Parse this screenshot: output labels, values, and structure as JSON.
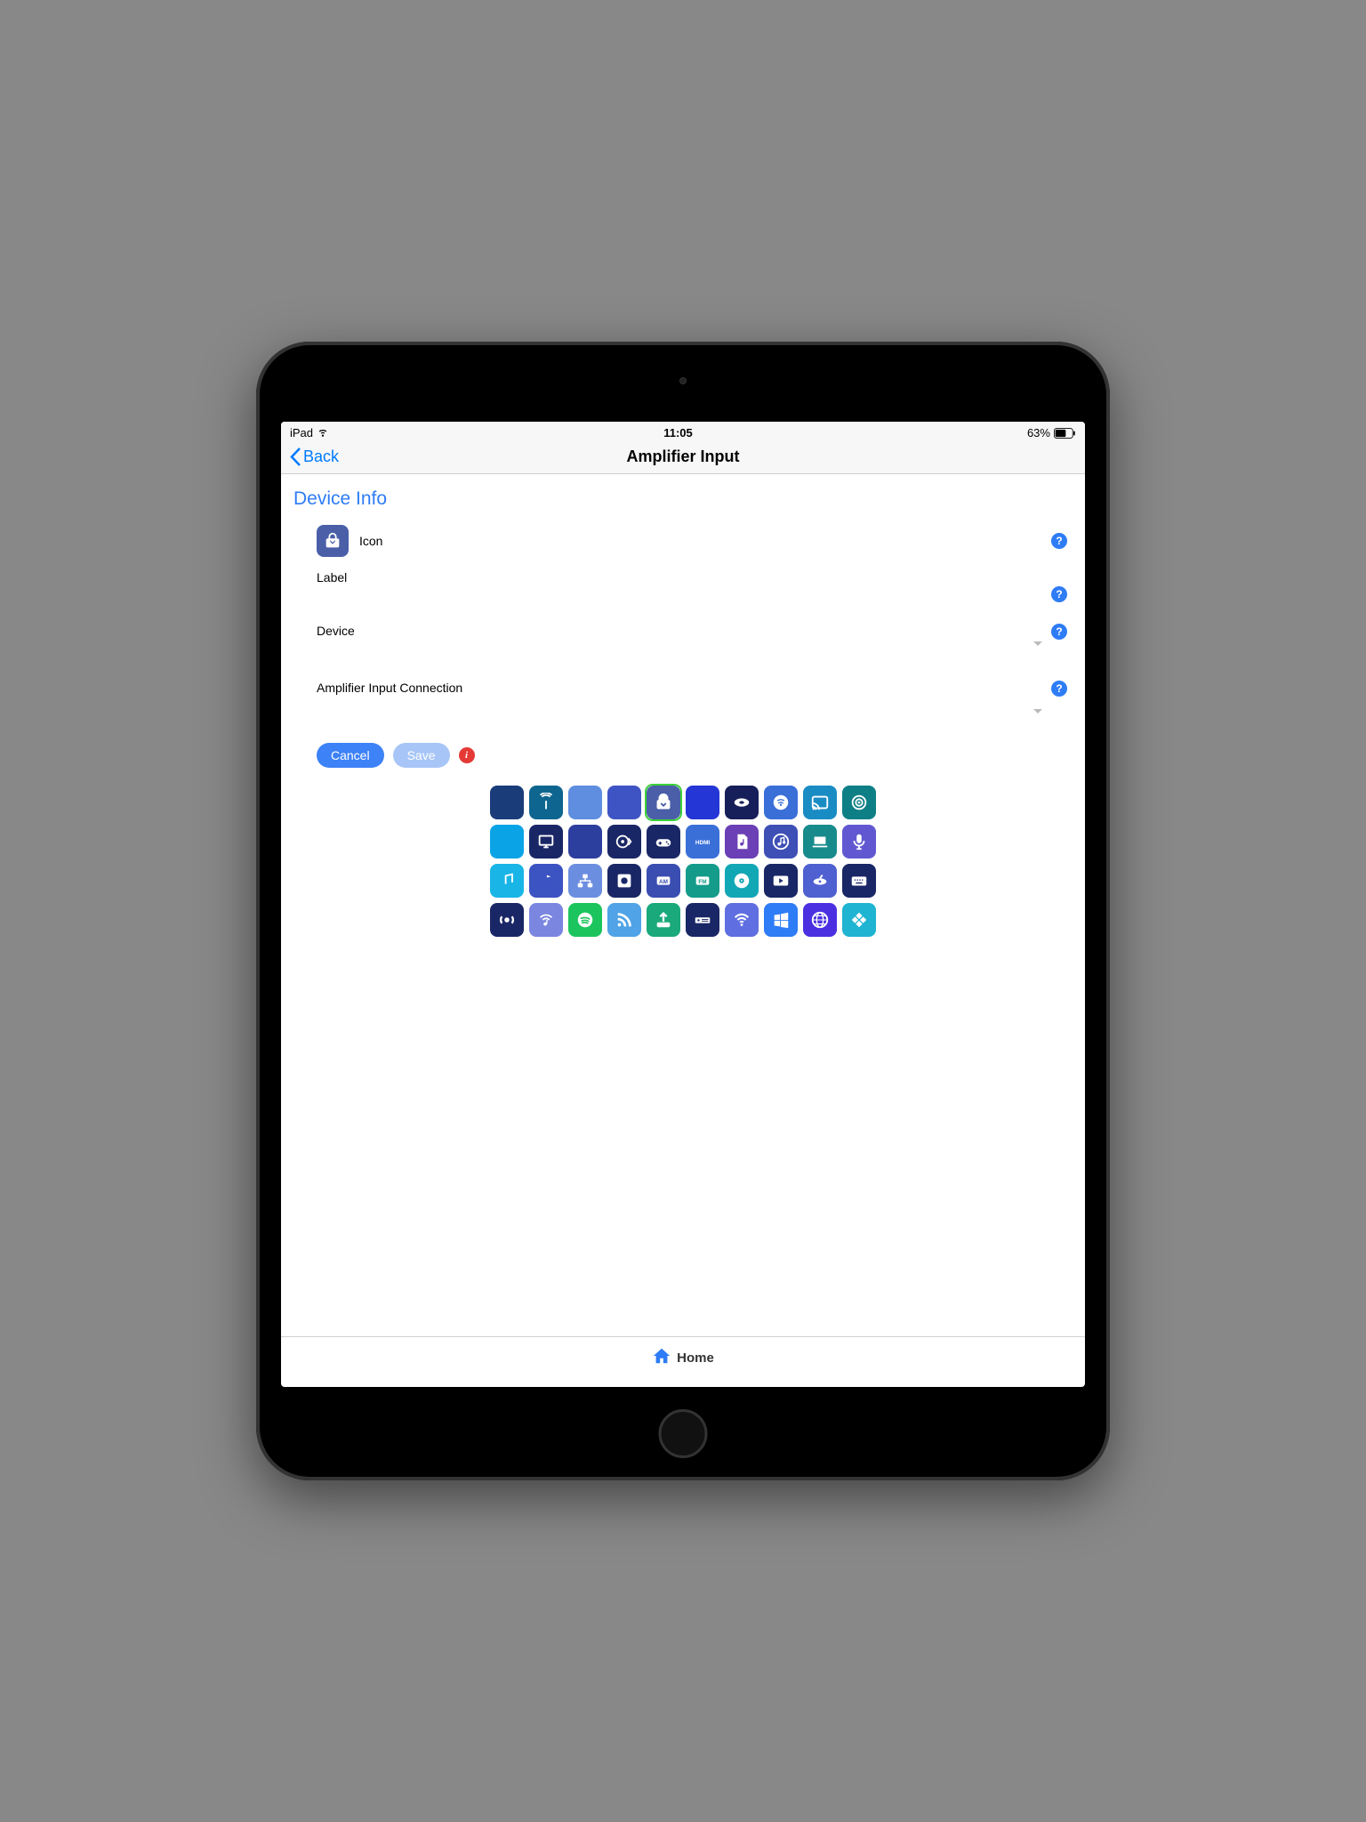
{
  "status": {
    "device": "iPad",
    "time": "11:05",
    "battery": "63%"
  },
  "nav": {
    "back": "Back",
    "title": "Amplifier Input"
  },
  "section": {
    "header": "Device Info"
  },
  "rows": {
    "icon_label": "Icon",
    "label_label": "Label",
    "device_label": "Device",
    "amp_input_label": "Amplifier Input Connection"
  },
  "buttons": {
    "cancel": "Cancel",
    "save": "Save"
  },
  "help_glyph": "?",
  "warn_glyph": "i",
  "icons": [
    {
      "name": "airplay",
      "color": "#1a3d7a"
    },
    {
      "name": "antenna",
      "color": "#0e6690"
    },
    {
      "name": "apple",
      "color": "#5f8de0"
    },
    {
      "name": "fan",
      "color": "#3f54c4"
    },
    {
      "name": "aux",
      "color": "#4a5fa8",
      "selected": true
    },
    {
      "name": "bluetooth",
      "color": "#2436d6"
    },
    {
      "name": "bluray",
      "color": "#171f5a"
    },
    {
      "name": "cable",
      "color": "#3a6fd8"
    },
    {
      "name": "cast",
      "color": "#1a8cc4"
    },
    {
      "name": "target",
      "color": "#0f7f86"
    },
    {
      "name": "dots",
      "color": "#0aa4e6"
    },
    {
      "name": "monitor",
      "color": "#1a2766"
    },
    {
      "name": "house",
      "color": "#2c3e9e"
    },
    {
      "name": "disc-arrow",
      "color": "#1a2766"
    },
    {
      "name": "gamepad",
      "color": "#1a2766"
    },
    {
      "name": "hdmi",
      "color": "#3a6fd8"
    },
    {
      "name": "file-music",
      "color": "#6b3fb5"
    },
    {
      "name": "itunes",
      "color": "#3e4fb5"
    },
    {
      "name": "laptop",
      "color": "#178a8c"
    },
    {
      "name": "mic",
      "color": "#6158d1"
    },
    {
      "name": "music-double",
      "color": "#18b5e6"
    },
    {
      "name": "music-note",
      "color": "#3c53c2"
    },
    {
      "name": "network",
      "color": "#6c8ee0"
    },
    {
      "name": "record",
      "color": "#1a2766"
    },
    {
      "name": "am",
      "color": "#3a4db0"
    },
    {
      "name": "fm",
      "color": "#149b8a"
    },
    {
      "name": "cd",
      "color": "#12a7b5"
    },
    {
      "name": "youtube",
      "color": "#1a2766"
    },
    {
      "name": "satellite",
      "color": "#4f60d0"
    },
    {
      "name": "keyboard",
      "color": "#1a2766"
    },
    {
      "name": "sonos",
      "color": "#1a2766"
    },
    {
      "name": "wifi-note",
      "color": "#7a86e0"
    },
    {
      "name": "spotify",
      "color": "#1cc45e"
    },
    {
      "name": "rss",
      "color": "#4fa3e6"
    },
    {
      "name": "upload",
      "color": "#1aa97a"
    },
    {
      "name": "receiver",
      "color": "#1a2766"
    },
    {
      "name": "wifi",
      "color": "#5f6ee0"
    },
    {
      "name": "windows",
      "color": "#2e7cf6"
    },
    {
      "name": "globe",
      "color": "#4a30e0"
    },
    {
      "name": "kodi",
      "color": "#1fb4d1"
    }
  ],
  "tabbar": {
    "home": "Home"
  }
}
